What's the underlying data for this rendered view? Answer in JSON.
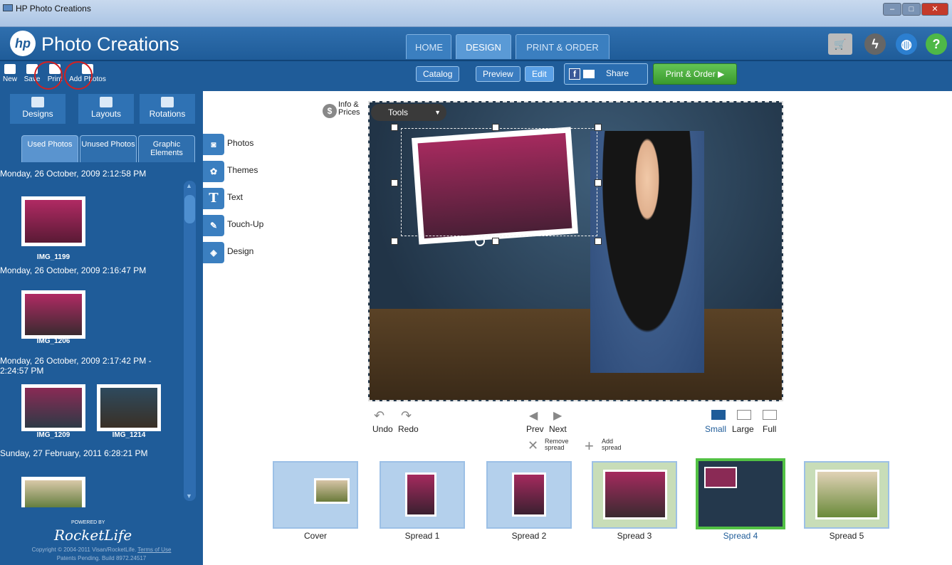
{
  "window": {
    "title": "HP Photo Creations"
  },
  "header": {
    "logo": "hp",
    "app_title": "Photo Creations",
    "tabs": [
      {
        "label": "HOME"
      },
      {
        "label": "DESIGN"
      },
      {
        "label": "PRINT & ORDER"
      }
    ],
    "icons": [
      "cart-icon",
      "power-icon",
      "globe-icon",
      "help-icon"
    ]
  },
  "toolbar": {
    "new": "New",
    "save": "Save",
    "print": "Print",
    "add_photos": "Add Photos",
    "catalog": "Catalog",
    "preview": "Preview",
    "edit": "Edit",
    "share": "Share",
    "print_order": "Print & Order"
  },
  "sidebar": {
    "design_tabs": [
      {
        "label": "Designs"
      },
      {
        "label": "Layouts"
      },
      {
        "label": "Rotations"
      }
    ],
    "photo_tabs": [
      {
        "label": "Used Photos"
      },
      {
        "label": "Unused Photos"
      },
      {
        "label": "Graphic Elements"
      }
    ],
    "groups": [
      {
        "date": "Monday, 26 October, 2009 2:12:58 PM",
        "photos": [
          "IMG_1199"
        ]
      },
      {
        "date": "Monday, 26 October, 2009 2:16:47 PM",
        "photos": [
          "IMG_1206"
        ]
      },
      {
        "date": "Monday, 26 October, 2009 2:17:42 PM - 2:24:57 PM",
        "photos": [
          "IMG_1209",
          "IMG_1214"
        ]
      },
      {
        "date": "Sunday, 27 February, 2011 6:28:21 PM",
        "photos": []
      }
    ],
    "powered_by": "POWERED BY",
    "brand": "RocketLife",
    "copyright": "Copyright © 2004-2011 Visan/RocketLife.",
    "terms": "Terms of Use",
    "patents": "Patents Pending. Build 8972.24517"
  },
  "workspace": {
    "info_prices": "Info & Prices",
    "tools": "Tools",
    "side_tabs": [
      {
        "label": "Photos"
      },
      {
        "label": "Themes"
      },
      {
        "label": "Text"
      },
      {
        "label": "Touch-Up"
      },
      {
        "label": "Design"
      }
    ],
    "undo": "Undo",
    "redo": "Redo",
    "prev": "Prev",
    "next": "Next",
    "remove_spread": "Remove spread",
    "add_spread": "Add spread",
    "sizes": [
      {
        "label": "Small"
      },
      {
        "label": "Large"
      },
      {
        "label": "Full"
      }
    ],
    "spreads": [
      {
        "label": "Cover"
      },
      {
        "label": "Spread 1"
      },
      {
        "label": "Spread 2"
      },
      {
        "label": "Spread 3"
      },
      {
        "label": "Spread 4"
      },
      {
        "label": "Spread 5"
      }
    ]
  },
  "colors": {
    "brand": "#1f5c99",
    "accent": "#52c144",
    "selected_text": "#1f5c99"
  }
}
